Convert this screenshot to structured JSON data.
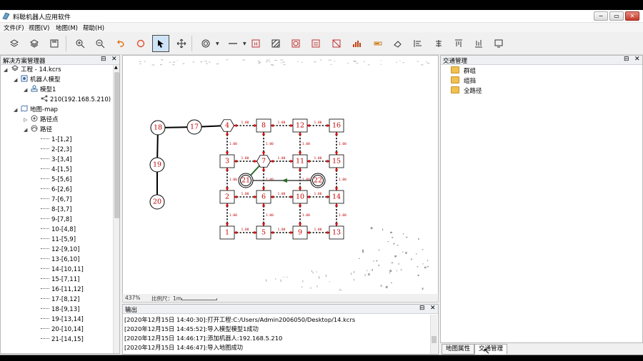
{
  "app": {
    "title": "料聪机器人应用软件"
  },
  "window_buttons": {
    "minimize": "─",
    "maximize": "▭",
    "close": "✕"
  },
  "menu": [
    "文件(F)",
    "视图(V)",
    "地图(M)",
    "帮助(H)"
  ],
  "toolbar": {
    "icons": [
      "layers-icon",
      "layers-stack-icon",
      "save-icon",
      "zoom-in-icon",
      "zoom-out-icon",
      "undo-icon",
      "redo-icon",
      "select-pointer-icon",
      "pan-move-icon",
      "target-node-icon",
      "line-segment-icon",
      "h-box-icon",
      "hatch-area-icon",
      "forbidden-box-icon",
      "speed-box-icon",
      "no-entry-box-icon",
      "bar-chart-icon",
      "charge-icon",
      "eraser-icon",
      "align-left-icon",
      "align-center-icon",
      "align-top-icon",
      "align-bottom-icon",
      "screen-icon"
    ],
    "active": "select-pointer-icon"
  },
  "solution_explorer": {
    "title": "解决方案管理器",
    "pin": "⊟",
    "close": "✕",
    "project": "工程 - 14.kcrs",
    "robot_model_group": "机器人模型",
    "model": "模型1",
    "robot": "210(192.168.5.210)",
    "map": "地图-map",
    "waypoints": "路径点",
    "paths": "路径",
    "path_items": [
      "1-[1,2]",
      "2-[2,3]",
      "3-[3,4]",
      "4-[1,5]",
      "5-[5,6]",
      "6-[2,6]",
      "7-[6,7]",
      "8-[3,7]",
      "9-[7,8]",
      "10-[4,8]",
      "11-[5,9]",
      "12-[9,10]",
      "13-[6,10]",
      "14-[10,11]",
      "15-[7,11]",
      "16-[11,12]",
      "17-[8,12]",
      "18-[9,13]",
      "19-[13,14]",
      "20-[10,14]",
      "21-[14,15]"
    ]
  },
  "map": {
    "zoom": "437%",
    "scale_label": "比例尺：1m",
    "grid_nodes": [
      {
        "id": "1",
        "col": 0,
        "row": 3
      },
      {
        "id": "2",
        "col": 0,
        "row": 2
      },
      {
        "id": "3",
        "col": 0,
        "row": 1
      },
      {
        "id": "5",
        "col": 1,
        "row": 3
      },
      {
        "id": "6",
        "col": 1,
        "row": 2
      },
      {
        "id": "8",
        "col": 1,
        "row": 0
      },
      {
        "id": "9",
        "col": 2,
        "row": 3
      },
      {
        "id": "10",
        "col": 2,
        "row": 2
      },
      {
        "id": "11",
        "col": 2,
        "row": 1
      },
      {
        "id": "12",
        "col": 2,
        "row": 0
      },
      {
        "id": "13",
        "col": 3,
        "row": 3
      },
      {
        "id": "14",
        "col": 3,
        "row": 2
      },
      {
        "id": "15",
        "col": 3,
        "row": 1
      },
      {
        "id": "16",
        "col": 3,
        "row": 0
      }
    ],
    "hex_nodes": [
      {
        "id": "4",
        "col": 0,
        "row": 0
      },
      {
        "id": "7",
        "col": 1,
        "row": 1
      }
    ],
    "circle_nodes": [
      {
        "id": "18"
      },
      {
        "id": "17"
      },
      {
        "id": "19"
      },
      {
        "id": "20"
      }
    ],
    "double_circle_nodes": [
      {
        "id": "21"
      },
      {
        "id": "22"
      }
    ],
    "edge_label": "1.00"
  },
  "output": {
    "title": "输出",
    "lines": [
      "[2020年12月15日 14:40:30]:打开工程:C:/Users/Admin2006050/Desktop/14.kcrs",
      "[2020年12月15日 14:45:52]:导入模型模型1成功",
      "[2020年12月15日 14:46:17]:添加机器人:192.168.5.210",
      "[2020年12月15日 14:46:47]:导入地图成功"
    ]
  },
  "traffic": {
    "title": "交通管理",
    "items": [
      "群组",
      "组挡",
      "全路径"
    ]
  },
  "right_tabs": [
    "地图属性",
    "交通管理"
  ],
  "colors": {
    "accent_red": "#c00000",
    "path_red": "#e01010",
    "path_green": "#2a6a2a"
  }
}
